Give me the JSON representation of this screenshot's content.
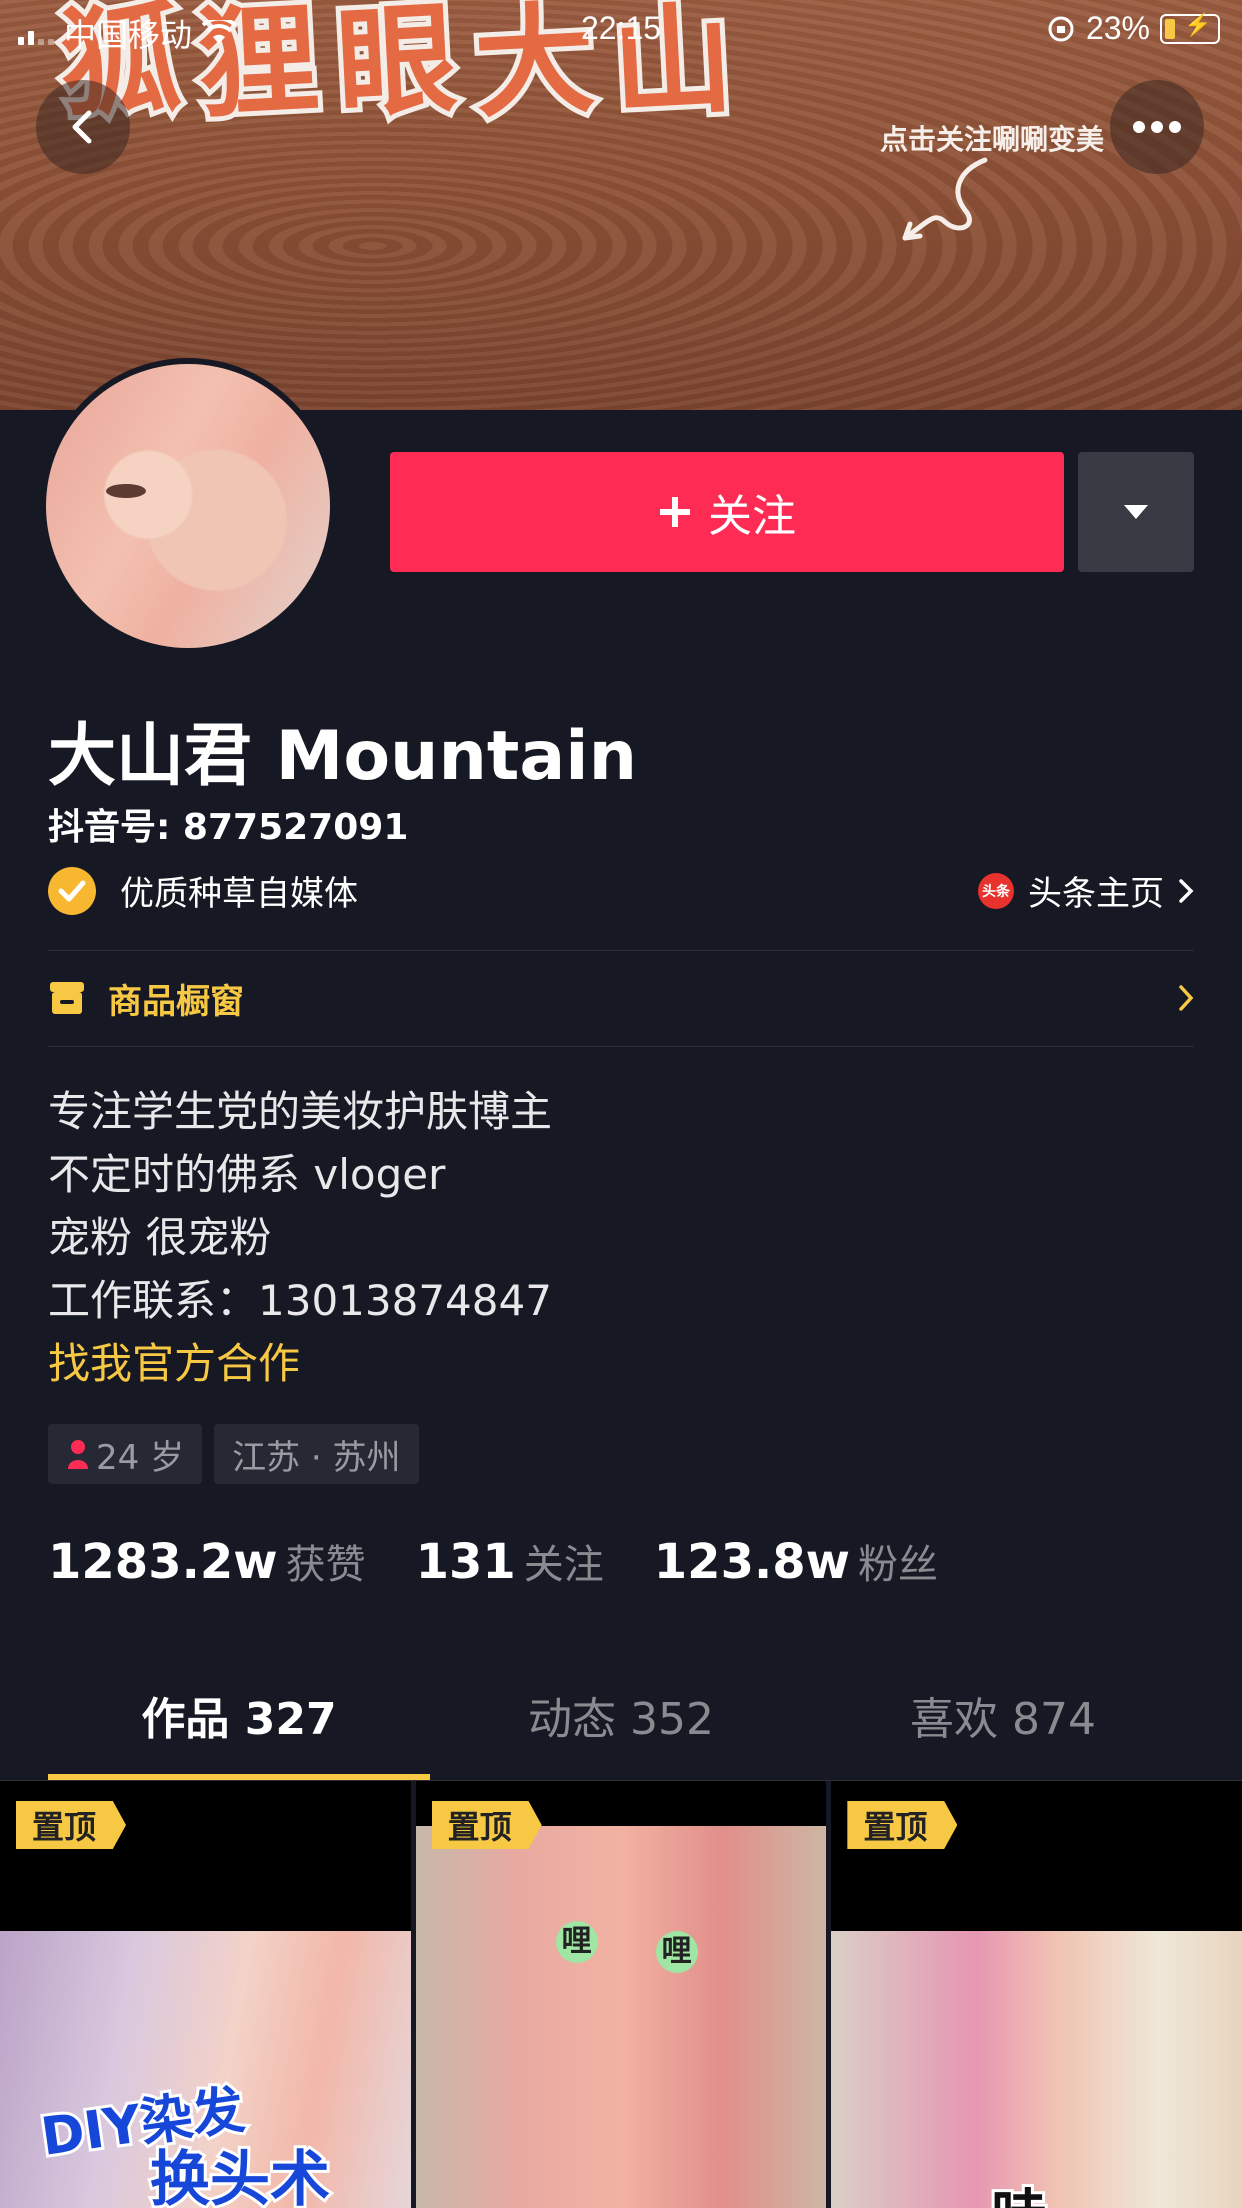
{
  "status_bar": {
    "carrier": "中国移动",
    "time": "22:15",
    "battery": "23%"
  },
  "banner": {
    "title_chars": [
      "狐",
      "狸",
      "眼",
      "大",
      "山"
    ],
    "hint": "点击关注唰唰变美"
  },
  "profile": {
    "follow_label": "关注",
    "name": "大山君 Mountain",
    "douyin_id": "抖音号: 877527091",
    "verification": "优质种草自媒体",
    "toutiao_logo": "头条",
    "toutiao_link": "头条主页",
    "shop_label": "商品橱窗",
    "bio": [
      "专注学生党的美妆护肤博主",
      "不定时的佛系 vloger",
      "宠粉 很宠粉",
      "工作联系：13013874847"
    ],
    "bio_link": "找我官方合作",
    "tags": {
      "age": "24 岁",
      "location": "江苏 · 苏州"
    }
  },
  "stats": [
    {
      "num": "1283.2w",
      "label": "获赞"
    },
    {
      "num": "131",
      "label": "关注"
    },
    {
      "num": "123.8w",
      "label": "粉丝"
    }
  ],
  "tabs": [
    {
      "label": "作品 327",
      "active": true
    },
    {
      "label": "动态 352",
      "active": false
    },
    {
      "label": "喜欢 874",
      "active": false
    }
  ],
  "videos": [
    {
      "pin": "置顶",
      "text_line1": "DIY染发",
      "text_line2": "换头术"
    },
    {
      "pin": "置顶",
      "text_line1": "哩",
      "text_line2": "哩"
    },
    {
      "pin": "置顶",
      "text_line1": "哇"
    }
  ],
  "colors": {
    "background": "#161823",
    "accent_red": "#fe2c55",
    "accent_yellow": "#f7c843"
  }
}
